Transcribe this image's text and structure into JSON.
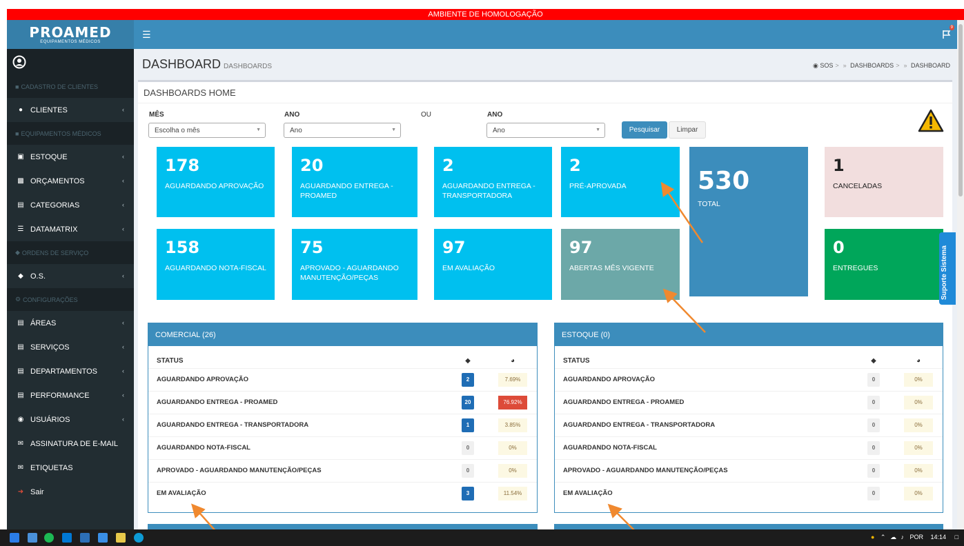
{
  "banner": "AMBIENTE DE HOMOLOGAÇÃO",
  "brand": {
    "name": "PROAMED",
    "tagline": "EQUIPAMENTOS MÉDICOS"
  },
  "notifications": {
    "count": "9"
  },
  "sidebar": {
    "sections": [
      {
        "header": "CADASTRO DE CLIENTES",
        "items": [
          {
            "label": "CLIENTES",
            "icon": "users-icon",
            "chevron": true
          }
        ]
      },
      {
        "header": "EQUIPAMENTOS MÉDICOS",
        "items": [
          {
            "label": "ESTOQUE",
            "icon": "camera-icon",
            "chevron": true
          },
          {
            "label": "ORÇAMENTOS",
            "icon": "money-icon",
            "chevron": true
          },
          {
            "label": "CATEGORIAS",
            "icon": "list-icon",
            "chevron": true
          },
          {
            "label": "DATAMATRIX",
            "icon": "barcode-icon",
            "chevron": true
          }
        ]
      },
      {
        "header": "ORDENS DE SERVIÇO",
        "items": [
          {
            "label": "O.S.",
            "icon": "tag-icon",
            "chevron": true
          }
        ]
      },
      {
        "header": "CONFIGURAÇÕES",
        "items": [
          {
            "label": "ÁREAS",
            "icon": "list-icon",
            "chevron": true
          },
          {
            "label": "SERVIÇOS",
            "icon": "list-icon",
            "chevron": true
          },
          {
            "label": "DEPARTAMENTOS",
            "icon": "list-icon",
            "chevron": true
          },
          {
            "label": "PERFORMANCE",
            "icon": "list-icon",
            "chevron": true
          },
          {
            "label": "USUÁRIOS",
            "icon": "user-circle-icon",
            "chevron": true
          },
          {
            "label": "ASSINATURA DE E-MAIL",
            "icon": "envelope-icon",
            "chevron": false
          },
          {
            "label": "ETIQUETAS",
            "icon": "envelope-icon",
            "chevron": false
          },
          {
            "label": "Sair",
            "icon": "sign-out-icon",
            "chevron": false
          }
        ]
      }
    ]
  },
  "page": {
    "title": "DASHBOARD",
    "subtitle": "DASHBOARDS",
    "box_title": "DASHBOARDS HOME"
  },
  "breadcrumb": [
    "SOS",
    "DASHBOARDS",
    "DASHBOARD"
  ],
  "filters": {
    "mes_label": "MÊS",
    "mes_value": "Escolha o mês",
    "ano_label": "ANO",
    "ano_value": "Ano",
    "ou": "OU",
    "ano2_label": "ANO",
    "ano2_value": "Ano",
    "search": "Pesquisar",
    "clear": "Limpar"
  },
  "tiles": [
    {
      "num": "178",
      "label": "AGUARDANDO APROVAÇÃO"
    },
    {
      "num": "20",
      "label": "AGUARDANDO ENTREGA - PROAMED"
    },
    {
      "num": "2",
      "label": "AGUARDANDO ENTREGA - TRANSPORTADORA"
    },
    {
      "num": "2",
      "label": "PRÉ-APROVADA"
    },
    {
      "num": "530",
      "label": "TOTAL"
    },
    {
      "num": "1",
      "label": "CANCELADAS"
    },
    {
      "num": "158",
      "label": "AGUARDANDO NOTA-FISCAL"
    },
    {
      "num": "75",
      "label": "APROVADO - AGUARDANDO MANUTENÇÃO/PEÇAS"
    },
    {
      "num": "97",
      "label": "EM AVALIAÇÃO"
    },
    {
      "num": "97",
      "label": "ABERTAS MÊS VIGENTE"
    },
    {
      "num": "0",
      "label": "ENTREGUES"
    }
  ],
  "comercial": {
    "title": "COMERCIAL (26)",
    "col_status": "STATUS",
    "rows": [
      {
        "status": "AGUARDANDO APROVAÇÃO",
        "count": "2",
        "pct": "7.69%"
      },
      {
        "status": "AGUARDANDO ENTREGA - PROAMED",
        "count": "20",
        "pct": "76.92%"
      },
      {
        "status": "AGUARDANDO ENTREGA - TRANSPORTADORA",
        "count": "1",
        "pct": "3.85%"
      },
      {
        "status": "AGUARDANDO NOTA-FISCAL",
        "count": "0",
        "pct": "0%"
      },
      {
        "status": "APROVADO - AGUARDANDO MANUTENÇÃO/PEÇAS",
        "count": "0",
        "pct": "0%"
      },
      {
        "status": "EM AVALIAÇÃO",
        "count": "3",
        "pct": "11.54%"
      }
    ]
  },
  "estoque": {
    "title": "ESTOQUE (0)",
    "col_status": "STATUS",
    "rows": [
      {
        "status": "AGUARDANDO APROVAÇÃO",
        "count": "0",
        "pct": "0%"
      },
      {
        "status": "AGUARDANDO ENTREGA - PROAMED",
        "count": "0",
        "pct": "0%"
      },
      {
        "status": "AGUARDANDO ENTREGA - TRANSPORTADORA",
        "count": "0",
        "pct": "0%"
      },
      {
        "status": "AGUARDANDO NOTA-FISCAL",
        "count": "0",
        "pct": "0%"
      },
      {
        "status": "APROVADO - AGUARDANDO MANUTENÇÃO/PEÇAS",
        "count": "0",
        "pct": "0%"
      },
      {
        "status": "EM AVALIAÇÃO",
        "count": "0",
        "pct": "0%"
      }
    ]
  },
  "support_tab": "Suporte Sistema",
  "taskbar": {
    "lang": "POR",
    "time": "14:14"
  },
  "colors": {
    "primary": "#3c8dbc",
    "aqua": "#00c0ef",
    "sidebar": "#222d32",
    "danger": "#dd4b39",
    "success": "#00a65a",
    "annotation": "#f0892f"
  }
}
